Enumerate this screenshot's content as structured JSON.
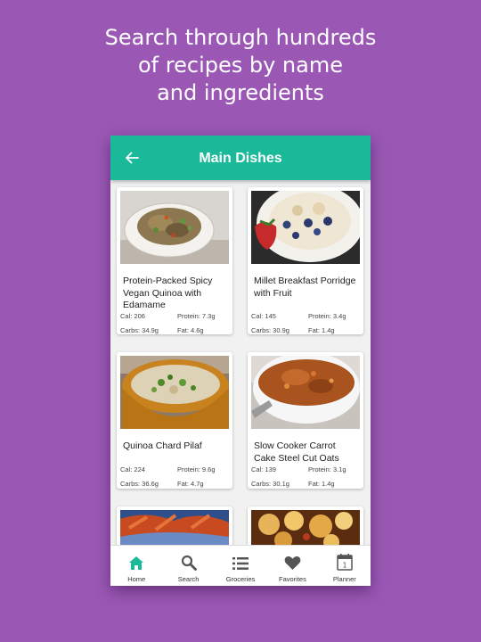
{
  "promo": {
    "line1": "Search through hundreds",
    "line2": "of recipes by name",
    "line3": "and ingredients"
  },
  "appbar": {
    "title": "Main Dishes",
    "back_icon": "back-arrow-icon"
  },
  "recipes": [
    {
      "name": "Protein-Packed Spicy Vegan Quinoa with Edamame",
      "cal": "Cal: 206",
      "protein": "Protein: 7.3g",
      "carbs": "Carbs: 34.9g",
      "fat": "Fat: 4.6g"
    },
    {
      "name": "Millet Breakfast Porridge with Fruit",
      "cal": "Cal: 145",
      "protein": "Protein: 3.4g",
      "carbs": "Carbs: 30.9g",
      "fat": "Fat: 1.4g"
    },
    {
      "name": "Quinoa Chard Pilaf",
      "cal": "Cal: 224",
      "protein": "Protein: 9.6g",
      "carbs": "Carbs: 36.6g",
      "fat": "Fat: 4.7g"
    },
    {
      "name": "Slow Cooker Carrot Cake Steel Cut Oats",
      "cal": "Cal: 139",
      "protein": "Protein: 3.1g",
      "carbs": "Carbs: 30.1g",
      "fat": "Fat: 1.4g"
    }
  ],
  "nav": {
    "active": "Home",
    "active_color": "#1ab99a",
    "items": [
      {
        "label": "Home",
        "icon": "home-icon"
      },
      {
        "label": "Search",
        "icon": "search-icon"
      },
      {
        "label": "Groceries",
        "icon": "list-icon"
      },
      {
        "label": "Favorites",
        "icon": "heart-icon"
      },
      {
        "label": "Planner",
        "icon": "calendar-icon"
      }
    ],
    "calendar_day": "1"
  },
  "colors": {
    "background": "#9a58b4",
    "appbar": "#1ab99a",
    "nav_icon": "#555555"
  }
}
